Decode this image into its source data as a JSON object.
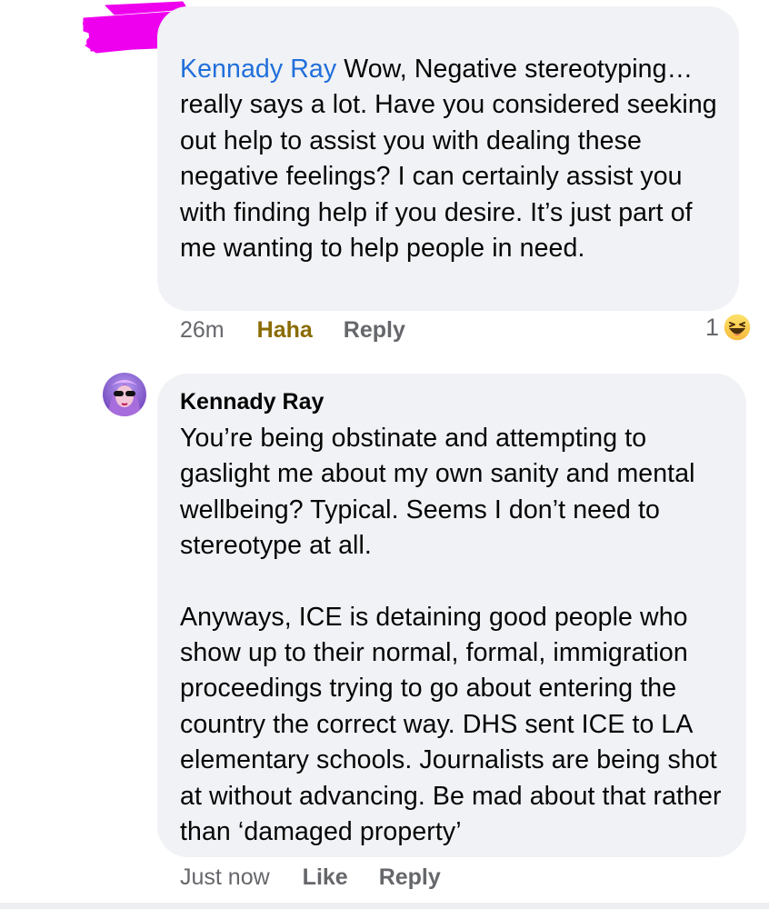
{
  "comment_1": {
    "author": "Kennady Ray",
    "body": " Wow, Negative stereotyping… really says a lot. Have you considered seeking out help to assist you with dealing these negative feelings? I can certainly assist you with finding help if you desire. It’s just part of me wanting to help people in need.",
    "timestamp": "26m",
    "actions": {
      "react_label": "Haha",
      "reply_label": "Reply"
    },
    "reactions": {
      "count": "1",
      "icon": "laughing-emoji-icon"
    }
  },
  "comment_2": {
    "author": "Kennady Ray",
    "paragraph_1": "You’re being obstinate and attempting to gaslight me about my own sanity and mental wellbeing? Typical. Seems I don’t need to stereotype at all.",
    "paragraph_2": "Anyways, ICE is detaining good people who show up to their normal, formal, immigration proceedings trying to go about entering the country the correct way. DHS sent ICE to LA elementary schools. Journalists are being shot at without advancing. Be mad about that rather than ‘damaged property’",
    "timestamp": "Just now",
    "actions": {
      "like_label": "Like",
      "reply_label": "Reply"
    }
  },
  "colors": {
    "bubble_bg": "#f0f2f5",
    "author_link": "#216fdb",
    "meta_text": "#65676b",
    "haha_text": "#8a6b00",
    "redaction": "#ee00ee"
  }
}
